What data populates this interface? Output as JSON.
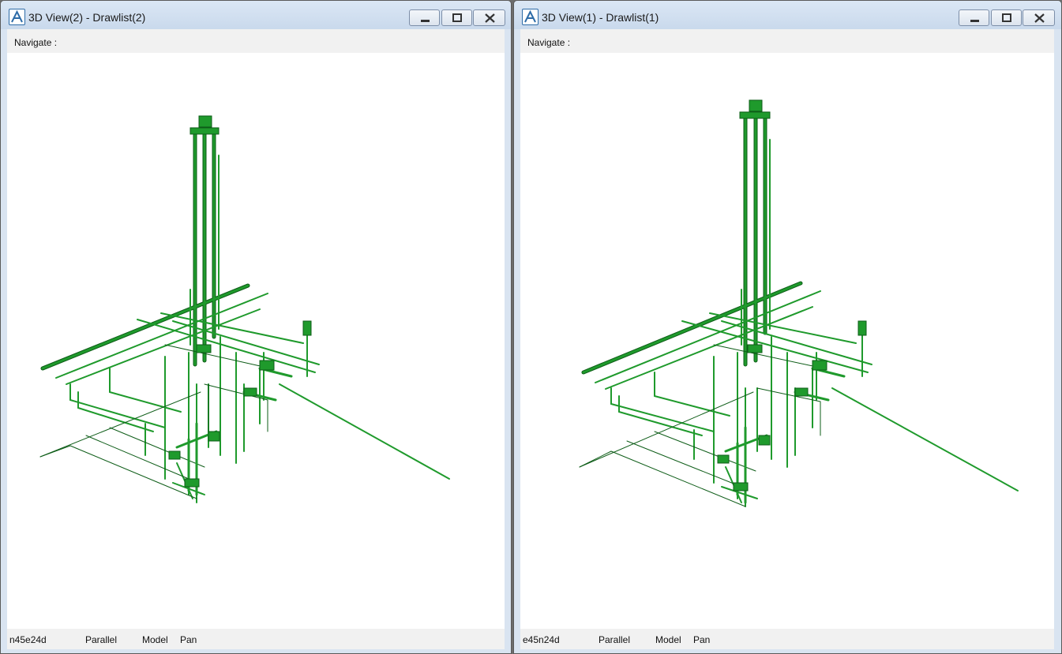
{
  "colors": {
    "pipe": "#1f9a2c",
    "pipe_dark": "#0d5c17",
    "background": "#ffffff",
    "bar": "#f1f1f1"
  },
  "windows": [
    {
      "id": "left",
      "title": "3D View(2) - Drawlist(2)",
      "icon": "aveva-a-icon",
      "navigate_label": "Navigate :",
      "status": {
        "direction": "n45e24d",
        "projection": "Parallel",
        "mode": "Model",
        "action": "Pan"
      }
    },
    {
      "id": "right",
      "title": "3D View(1) - Drawlist(1)",
      "icon": "aveva-a-icon",
      "navigate_label": "Navigate :",
      "status": {
        "direction": "e45n24d",
        "projection": "Parallel",
        "mode": "Model",
        "action": "Pan"
      }
    }
  ]
}
